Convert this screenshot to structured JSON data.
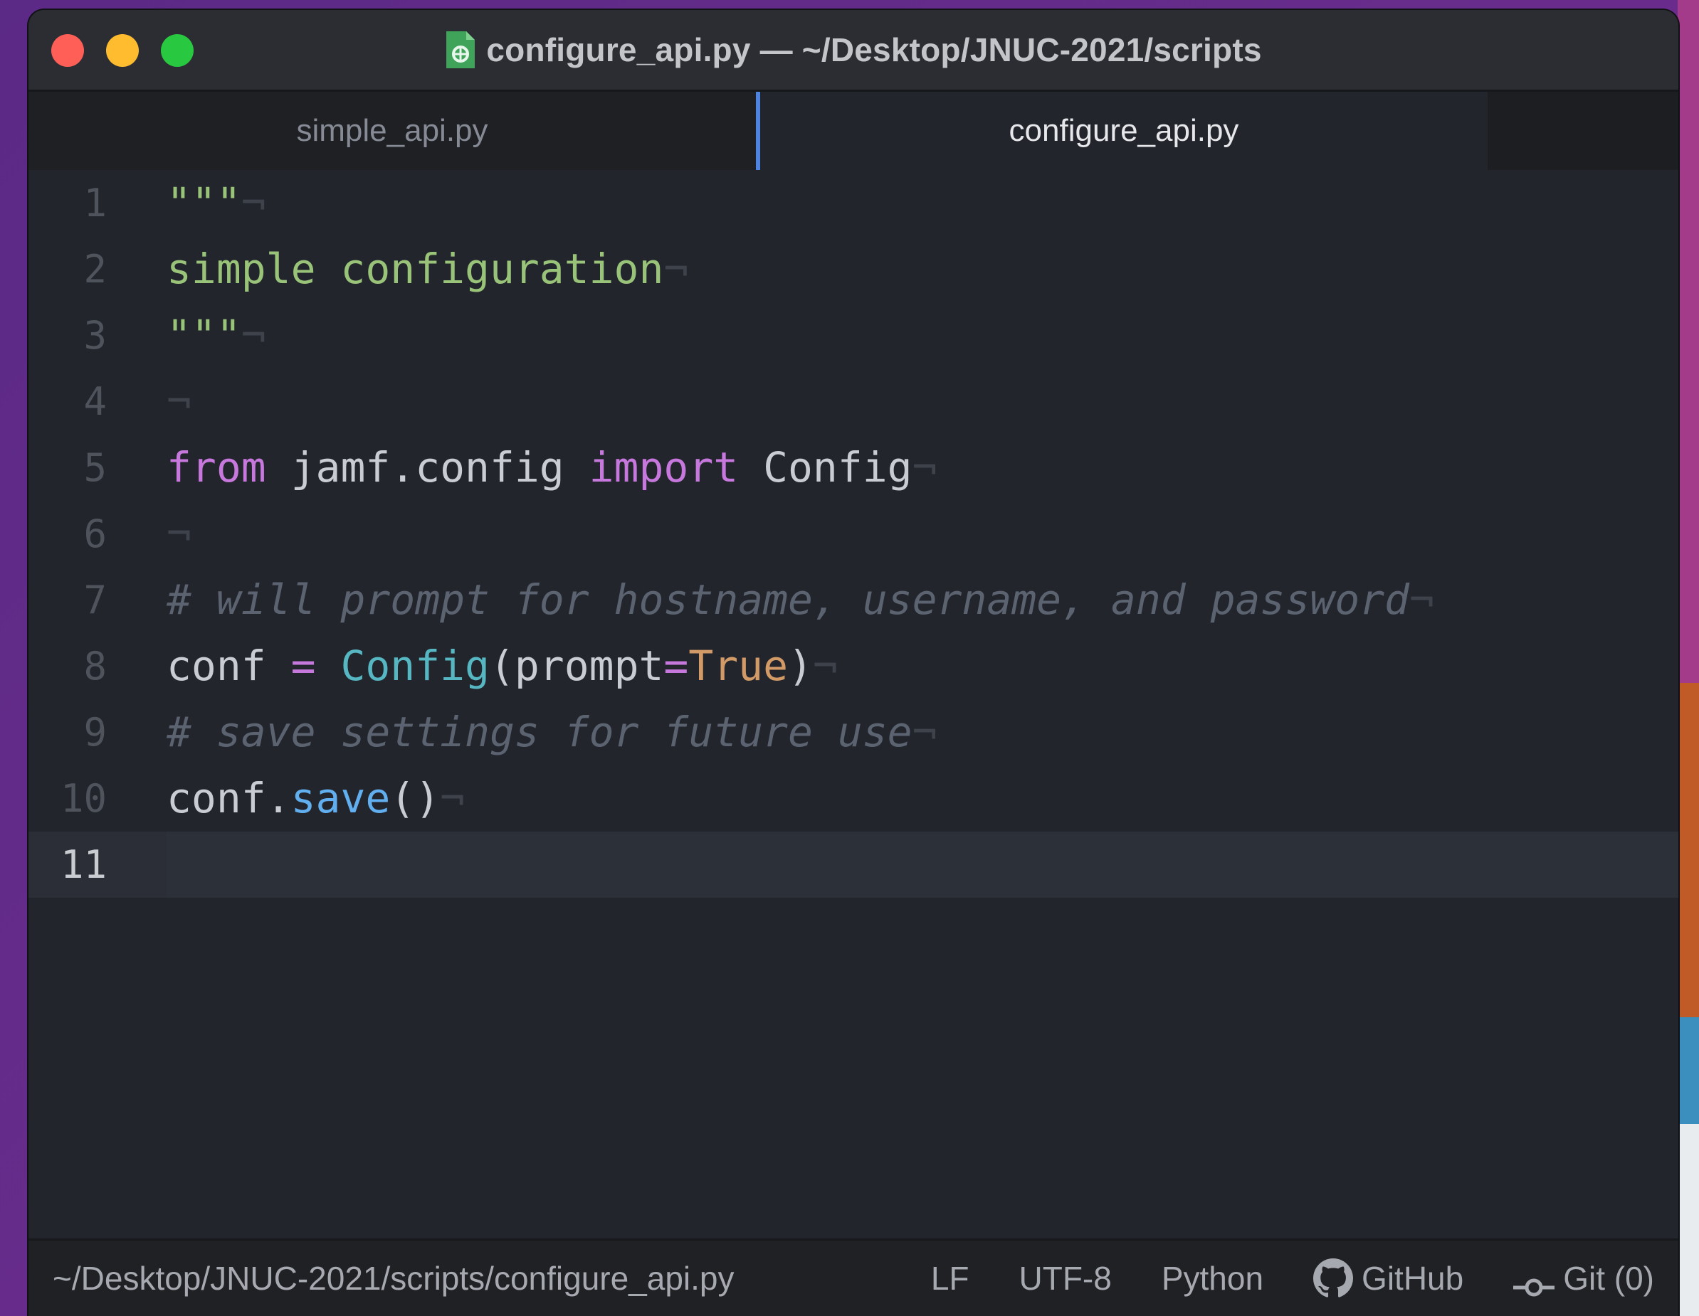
{
  "window": {
    "title": "configure_api.py — ~/Desktop/JNUC-2021/scripts"
  },
  "tabs": [
    {
      "label": "simple_api.py",
      "active": false
    },
    {
      "label": "configure_api.py",
      "active": true
    }
  ],
  "editor": {
    "language": "Python",
    "current_line": 11,
    "lines": [
      {
        "number": "1",
        "text": "\"\"\"¬"
      },
      {
        "number": "2",
        "text": "simple configuration¬"
      },
      {
        "number": "3",
        "text": "\"\"\"¬"
      },
      {
        "number": "4",
        "text": "¬"
      },
      {
        "number": "5",
        "text": "from jamf.config import Config¬"
      },
      {
        "number": "6",
        "text": "¬"
      },
      {
        "number": "7",
        "text": "# will prompt for hostname, username, and password¬"
      },
      {
        "number": "8",
        "text": "conf = Config(prompt=True)¬"
      },
      {
        "number": "9",
        "text": "# save settings for future use¬"
      },
      {
        "number": "10",
        "text": "conf.save()¬"
      },
      {
        "number": "11",
        "text": ""
      }
    ]
  },
  "statusbar": {
    "path": "~/Desktop/JNUC-2021/scripts/configure_api.py",
    "line_ending": "LF",
    "encoding": "UTF-8",
    "grammar": "Python",
    "github_label": "GitHub",
    "git_label": "Git (0)"
  },
  "colors": {
    "string": "#98c379",
    "keyword": "#c678dd",
    "class": "#56b6c2",
    "constant": "#d19a66",
    "function": "#61afef",
    "comment": "#5c6370",
    "active_tab_border": "#4d84e0"
  }
}
